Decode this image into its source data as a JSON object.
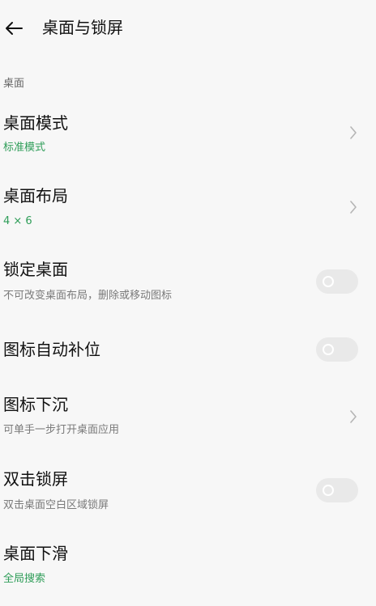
{
  "header": {
    "back_icon": "arrow-left-icon",
    "title": "桌面与锁屏"
  },
  "section": {
    "label": "桌面"
  },
  "colors": {
    "accent": "#2e9d58",
    "background": "#f7f7f7",
    "toggle_off": "#e9e9e9"
  },
  "items": [
    {
      "title": "桌面模式",
      "subtitle": "标准模式",
      "subtitle_style": "accent",
      "control": "chevron"
    },
    {
      "title": "桌面布局",
      "subtitle": "4 × 6",
      "subtitle_style": "accent",
      "control": "chevron"
    },
    {
      "title": "锁定桌面",
      "subtitle": "不可改变桌面布局，删除或移动图标",
      "subtitle_style": "muted",
      "control": "toggle",
      "toggle_on": false
    },
    {
      "title": "图标自动补位",
      "subtitle": "",
      "subtitle_style": "muted",
      "control": "toggle",
      "toggle_on": false
    },
    {
      "title": "图标下沉",
      "subtitle": "可单手一步打开桌面应用",
      "subtitle_style": "muted",
      "control": "chevron"
    },
    {
      "title": "双击锁屏",
      "subtitle": "双击桌面空白区域锁屏",
      "subtitle_style": "muted",
      "control": "toggle",
      "toggle_on": false
    },
    {
      "title": "桌面下滑",
      "subtitle": "全局搜索",
      "subtitle_style": "accent",
      "control": "none"
    }
  ]
}
